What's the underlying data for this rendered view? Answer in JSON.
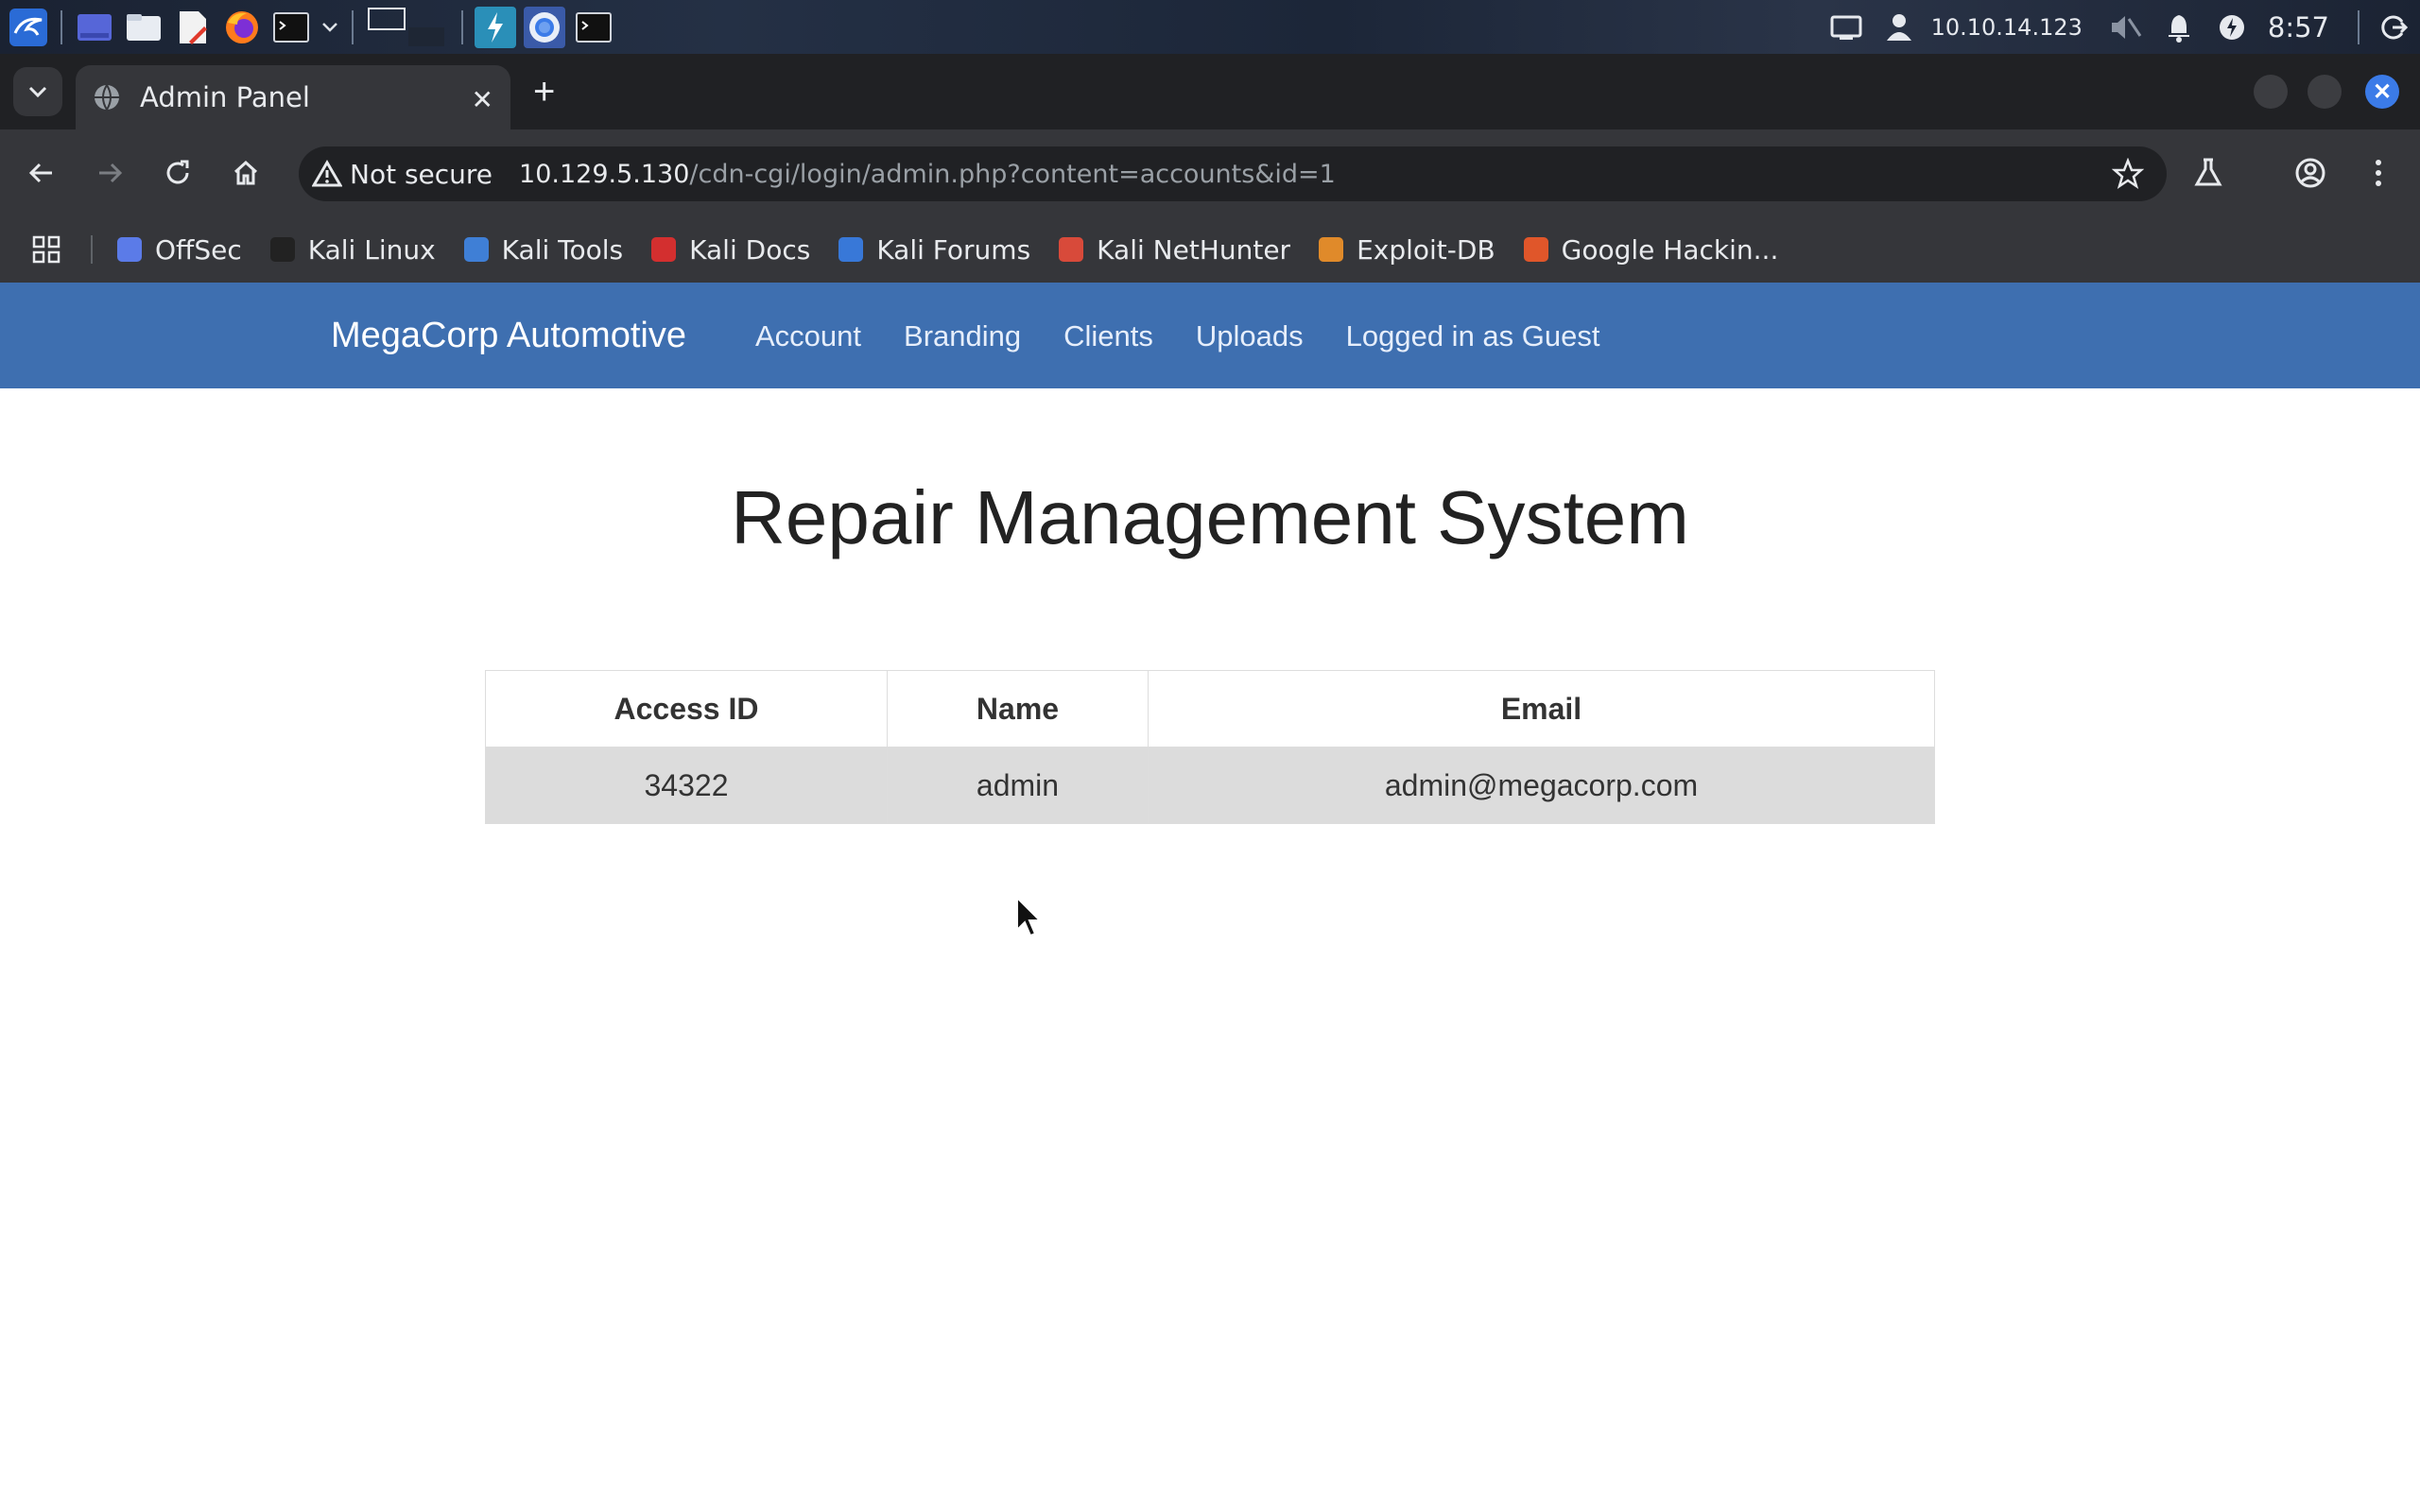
{
  "taskbar": {
    "apps": [
      "kali-menu-icon",
      "workspace-icon",
      "file-manager-icon",
      "text-editor-icon",
      "firefox-icon",
      "terminal-icon",
      "chevron-down-icon"
    ],
    "ip": "10.10.14.123",
    "clock": "8:57"
  },
  "browser": {
    "tab_title": "Admin Panel",
    "security_label": "Not secure",
    "url_host": "10.129.5.130",
    "url_path": "/cdn-cgi/login/admin.php?content=accounts&id=1",
    "bookmarks": [
      "OffSec",
      "Kali Linux",
      "Kali Tools",
      "Kali Docs",
      "Kali Forums",
      "Kali NetHunter",
      "Exploit-DB",
      "Google Hackin..."
    ],
    "bookmark_colors": [
      "#5b7be8",
      "#222222",
      "#3f7fd6",
      "#d32f2f",
      "#3878d8",
      "#d84a3a",
      "#e08a2a",
      "#e0562a"
    ]
  },
  "site": {
    "brand": "MegaCorp Automotive",
    "nav": [
      "Account",
      "Branding",
      "Clients",
      "Uploads",
      "Logged in as Guest"
    ],
    "nav_color": "#3e6fb0"
  },
  "main": {
    "title": "Repair Management System",
    "table": {
      "headers": [
        "Access ID",
        "Name",
        "Email"
      ],
      "rows": [
        [
          "34322",
          "admin",
          "admin@megacorp.com"
        ]
      ]
    }
  }
}
